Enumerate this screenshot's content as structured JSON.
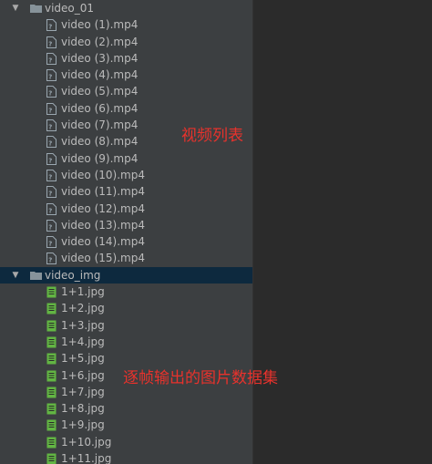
{
  "tree": {
    "folders": [
      {
        "name": "video_01",
        "expanded": true,
        "icon": "folder-icon",
        "items": [
          "video (1).mp4",
          "video (2).mp4",
          "video (3).mp4",
          "video (4).mp4",
          "video (5).mp4",
          "video (6).mp4",
          "video (7).mp4",
          "video (8).mp4",
          "video (9).mp4",
          "video (10).mp4",
          "video (11).mp4",
          "video (12).mp4",
          "video (13).mp4",
          "video (14).mp4",
          "video (15).mp4"
        ],
        "item_icon": "video-file-icon"
      },
      {
        "name": "video_img",
        "expanded": true,
        "selected": true,
        "icon": "folder-icon",
        "items": [
          "1+1.jpg",
          "1+2.jpg",
          "1+3.jpg",
          "1+4.jpg",
          "1+5.jpg",
          "1+6.jpg",
          "1+7.jpg",
          "1+8.jpg",
          "1+9.jpg",
          "1+10.jpg",
          "1+11.jpg"
        ],
        "item_icon": "image-file-icon"
      }
    ]
  },
  "annotations": {
    "video_list": "视频列表",
    "frame_dataset": "逐帧输出的图片数据集"
  },
  "colors": {
    "panel_bg": "#3c3f41",
    "editor_bg": "#2b2b2b",
    "selection_bg": "#0d293e",
    "text": "#bbbbbb",
    "annotation": "#e8322c"
  }
}
